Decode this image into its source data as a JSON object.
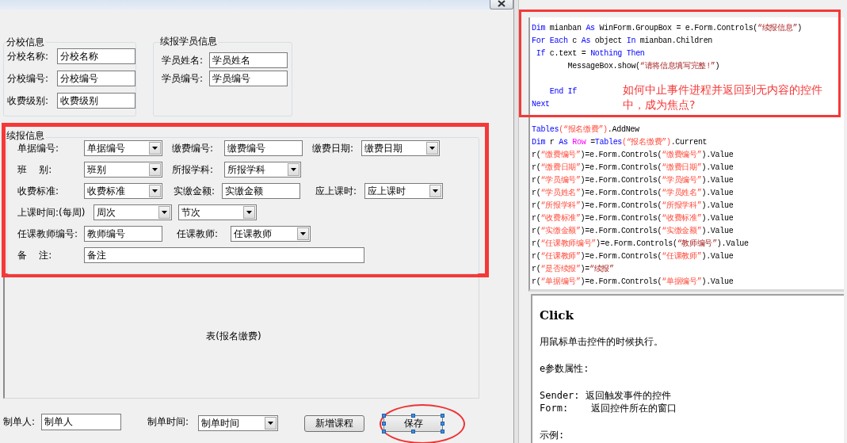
{
  "designer": {
    "groups": [
      {
        "title": "分校信息",
        "fields": [
          {
            "label": "分校名称:",
            "kind": "text",
            "value": "分校名称"
          },
          {
            "label": "分校编号:",
            "kind": "text",
            "value": "分校编号"
          },
          {
            "label": "收费级别:",
            "kind": "text",
            "value": "收费级别"
          }
        ]
      },
      {
        "title": "续报学员信息",
        "fields": [
          {
            "label": "学员姓名:",
            "kind": "text",
            "value": "学员姓名"
          },
          {
            "label": "学员编号:",
            "kind": "text",
            "value": "学员编号"
          }
        ]
      }
    ],
    "main_group": {
      "title": "续报信息",
      "rows": [
        [
          {
            "kind": "label",
            "text": "单据编号:"
          },
          {
            "kind": "combo",
            "value": "单据编号"
          },
          {
            "kind": "label",
            "text": "缴费编号:"
          },
          {
            "kind": "text",
            "value": "缴费编号"
          },
          {
            "kind": "label",
            "text": "缴费日期:"
          },
          {
            "kind": "combo",
            "value": "缴费日期"
          }
        ],
        [
          {
            "kind": "label",
            "text": "班    别:"
          },
          {
            "kind": "combo",
            "value": "班别"
          },
          {
            "kind": "label",
            "text": "所报学科:"
          },
          {
            "kind": "combo",
            "value": "所报学科"
          }
        ],
        [
          {
            "kind": "label",
            "text": "收费标准:"
          },
          {
            "kind": "combo",
            "value": "收费标准"
          },
          {
            "kind": "label",
            "text": "实缴金额:"
          },
          {
            "kind": "text",
            "value": "实缴金额"
          },
          {
            "kind": "label",
            "text": "应上课时:"
          },
          {
            "kind": "combo",
            "value": "应上课时"
          }
        ],
        [
          {
            "kind": "label",
            "text": "上课时间:(每周)"
          },
          {
            "kind": "combo",
            "value": "周次"
          },
          {
            "kind": "combo",
            "value": "节次"
          }
        ],
        [
          {
            "kind": "label",
            "text": "任课教师编号:"
          },
          {
            "kind": "text",
            "value": "教师编号"
          },
          {
            "kind": "label",
            "text": "任课教师:"
          },
          {
            "kind": "combo",
            "value": "任课教师"
          }
        ],
        [
          {
            "kind": "label",
            "text": "备    注:"
          },
          {
            "kind": "text",
            "value": "备注"
          }
        ]
      ]
    },
    "table_label": "表(报名缴费)",
    "footer": [
      {
        "kind": "label",
        "text": "制单人:"
      },
      {
        "kind": "text",
        "value": "制单人"
      },
      {
        "kind": "label",
        "text": "制单时间:"
      },
      {
        "kind": "combo",
        "value": "制单时间"
      },
      {
        "kind": "button",
        "text": "新增课程",
        "selected": false
      },
      {
        "kind": "button",
        "text": "保存",
        "selected": true
      }
    ]
  },
  "code_editor": {
    "lines": [
      {
        "kind": "code",
        "segs": [
          {
            "kind": "kw",
            "t": "Dim"
          },
          {
            "kind": "plain",
            "t": " mianban "
          },
          {
            "kind": "kw",
            "t": "As"
          },
          {
            "kind": "plain",
            "t": " WinForm.GroupBox = e.Form.Controls("
          },
          {
            "kind": "str2",
            "t": "“续报信息”"
          },
          {
            "kind": "plain",
            "t": ")"
          }
        ]
      },
      {
        "kind": "code",
        "segs": [
          {
            "kind": "kw",
            "t": "For Each"
          },
          {
            "kind": "plain",
            "t": " c "
          },
          {
            "kind": "kw",
            "t": "As"
          },
          {
            "kind": "plain",
            "t": " object "
          },
          {
            "kind": "kw",
            "t": "In"
          },
          {
            "kind": "plain",
            "t": " mianban.Children"
          }
        ]
      },
      {
        "kind": "code",
        "segs": [
          {
            "kind": "kw",
            "t": " If"
          },
          {
            "kind": "plain",
            "t": " c.text = "
          },
          {
            "kind": "kw",
            "t": "Nothing Then"
          }
        ]
      },
      {
        "kind": "code",
        "segs": [
          {
            "kind": "plain",
            "t": "        MessageBox.show("
          },
          {
            "kind": "str2",
            "t": "“请将信息填写完整!”"
          },
          {
            "kind": "plain",
            "t": ")"
          }
        ]
      },
      {
        "kind": "blank"
      },
      {
        "kind": "code",
        "segs": [
          {
            "kind": "kw",
            "t": "    End If"
          }
        ]
      },
      {
        "kind": "code",
        "segs": [
          {
            "kind": "kw",
            "t": "Next"
          }
        ]
      },
      {
        "kind": "blank"
      },
      {
        "kind": "code",
        "segs": [
          {
            "kind": "kw",
            "t": "Tables"
          },
          {
            "kind": "str",
            "t": "(“报名缴费”)"
          },
          {
            "kind": "plain",
            "t": ".AddNew"
          }
        ]
      },
      {
        "kind": "code",
        "segs": [
          {
            "kind": "kw",
            "t": "Dim"
          },
          {
            "kind": "plain",
            "t": " r "
          },
          {
            "kind": "kw",
            "t": "As "
          },
          {
            "kind": "type",
            "t": "Row"
          },
          {
            "kind": "plain",
            "t": " ="
          },
          {
            "kind": "kw",
            "t": "Tables"
          },
          {
            "kind": "str",
            "t": "(“报名缴费”)"
          },
          {
            "kind": "plain",
            "t": ".Current"
          }
        ]
      },
      {
        "kind": "code",
        "segs": [
          {
            "kind": "plain",
            "t": "r("
          },
          {
            "kind": "str",
            "t": "“缴费编号”"
          },
          {
            "kind": "plain",
            "t": ")=e.Form.Controls("
          },
          {
            "kind": "str",
            "t": "“缴费编号”"
          },
          {
            "kind": "plain",
            "t": ").Value"
          }
        ]
      },
      {
        "kind": "code",
        "segs": [
          {
            "kind": "plain",
            "t": "r("
          },
          {
            "kind": "str",
            "t": "“缴费日期”"
          },
          {
            "kind": "plain",
            "t": ")=e.Form.Controls("
          },
          {
            "kind": "str",
            "t": "“缴费日期”"
          },
          {
            "kind": "plain",
            "t": ").Value"
          }
        ]
      },
      {
        "kind": "code",
        "segs": [
          {
            "kind": "plain",
            "t": "r("
          },
          {
            "kind": "str",
            "t": "“学员编号”"
          },
          {
            "kind": "plain",
            "t": ")=e.Form.Controls("
          },
          {
            "kind": "str",
            "t": "“学员编号”"
          },
          {
            "kind": "plain",
            "t": ").Value"
          }
        ]
      },
      {
        "kind": "code",
        "segs": [
          {
            "kind": "plain",
            "t": "r("
          },
          {
            "kind": "str",
            "t": "“学员姓名”"
          },
          {
            "kind": "plain",
            "t": ")=e.Form.Controls("
          },
          {
            "kind": "str",
            "t": "“学员姓名”"
          },
          {
            "kind": "plain",
            "t": ").Value"
          }
        ]
      },
      {
        "kind": "code",
        "segs": [
          {
            "kind": "plain",
            "t": "r("
          },
          {
            "kind": "str",
            "t": "“所报学科”"
          },
          {
            "kind": "plain",
            "t": ")=e.Form.Controls("
          },
          {
            "kind": "str",
            "t": "“所报学科”"
          },
          {
            "kind": "plain",
            "t": ").Value"
          }
        ]
      },
      {
        "kind": "code",
        "segs": [
          {
            "kind": "plain",
            "t": "r("
          },
          {
            "kind": "str",
            "t": "“收费标准”"
          },
          {
            "kind": "plain",
            "t": ")=e.Form.Controls("
          },
          {
            "kind": "str",
            "t": "“收费标准”"
          },
          {
            "kind": "plain",
            "t": ").Value"
          }
        ]
      },
      {
        "kind": "code",
        "segs": [
          {
            "kind": "plain",
            "t": "r("
          },
          {
            "kind": "str",
            "t": "“实缴金额”"
          },
          {
            "kind": "plain",
            "t": ")=e.Form.Controls("
          },
          {
            "kind": "str",
            "t": "“实缴金额”"
          },
          {
            "kind": "plain",
            "t": ").Value"
          }
        ]
      },
      {
        "kind": "code",
        "segs": [
          {
            "kind": "plain",
            "t": "r("
          },
          {
            "kind": "str",
            "t": "“任课教师编号”"
          },
          {
            "kind": "plain",
            "t": ")=e.Form.Controls("
          },
          {
            "kind": "str2",
            "t": "“教师编号”"
          },
          {
            "kind": "plain",
            "t": ").Value"
          }
        ]
      },
      {
        "kind": "code",
        "segs": [
          {
            "kind": "plain",
            "t": "r("
          },
          {
            "kind": "str",
            "t": "“任课教师”"
          },
          {
            "kind": "plain",
            "t": ")=e.Form.Controls("
          },
          {
            "kind": "str",
            "t": "“任课教师”"
          },
          {
            "kind": "plain",
            "t": ").Value"
          }
        ]
      },
      {
        "kind": "code",
        "segs": [
          {
            "kind": "plain",
            "t": "r("
          },
          {
            "kind": "str",
            "t": "“是否续报”"
          },
          {
            "kind": "plain",
            "t": ")="
          },
          {
            "kind": "str2",
            "t": "“续报”"
          }
        ]
      },
      {
        "kind": "code",
        "segs": [
          {
            "kind": "plain",
            "t": "r("
          },
          {
            "kind": "str",
            "t": "“单据编号”"
          },
          {
            "kind": "plain",
            "t": ")=e.Form.Controls("
          },
          {
            "kind": "str",
            "t": "“单据编号”"
          },
          {
            "kind": "plain",
            "t": ").Value"
          }
        ]
      }
    ],
    "note": "如何中止事件进程并返回到无内容的控件中，成为焦点?"
  },
  "help": {
    "title": "Click",
    "paragraphs": [
      [
        "用鼠标单击控件的时候执行。"
      ],
      [
        "e参数属性:"
      ],
      [
        "Sender: 返回触发事件的控件",
        "Form:    返回控件所在的窗口"
      ],
      [
        "示例:"
      ]
    ]
  }
}
